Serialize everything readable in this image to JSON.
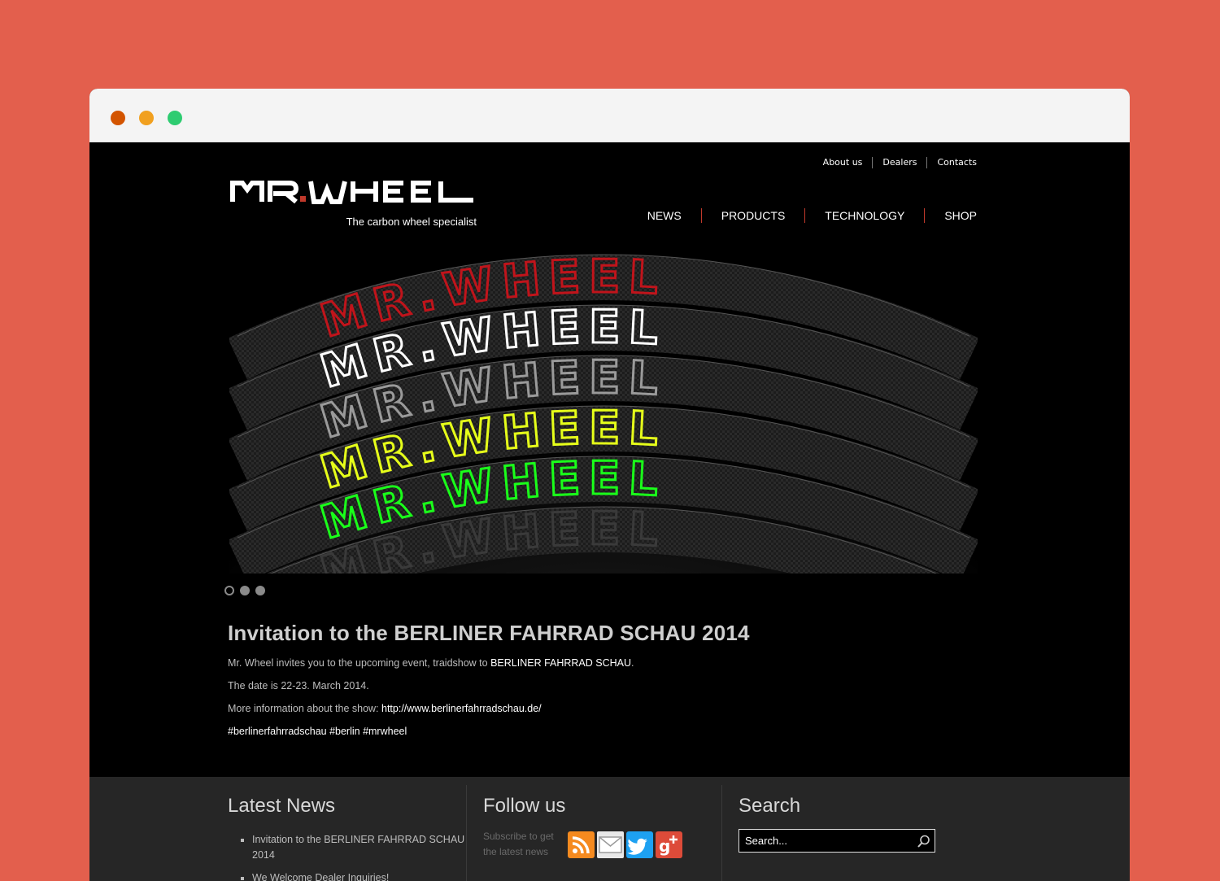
{
  "topnav": {
    "items": [
      "About us",
      "Dealers",
      "Contacts"
    ]
  },
  "logo": {
    "text": "MR. WHEEL",
    "tagline": "The carbon wheel specialist"
  },
  "mainnav": {
    "items": [
      "NEWS",
      "PRODUCTS",
      "TECHNOLOGY",
      "SHOP"
    ]
  },
  "hero": {
    "rim_text": "MR.WHEEL",
    "rim_colors": [
      "#c0141b",
      "#ffffff",
      "#9a9a9a",
      "#e6ff1a",
      "#1aff1a",
      "#3a3a3a"
    ]
  },
  "slider": {
    "count": 3,
    "active_index": 0
  },
  "article": {
    "title": "Invitation to the BERLINER FAHRRAD SCHAU 2014",
    "p1_prefix": "Mr. Wheel invites you to the upcoming event, traidshow to ",
    "p1_highlight": "BERLINER FAHRRAD SCHAU",
    "p1_suffix": ".",
    "p2": "The date is 22-23. March 2014.",
    "p3_prefix": "More information about the show: ",
    "p3_link": "http://www.berlinerfahrradschau.de/",
    "p4": "#berlinerfahrradschau #berlin #mrwheel"
  },
  "footer": {
    "latest_news": {
      "heading": "Latest News",
      "items": [
        "Invitation to the BERLINER FAHRRAD SCHAU 2014",
        "We Welcome Dealer Inquiries!"
      ]
    },
    "follow": {
      "heading": "Follow us",
      "subscribe_text": "Subscribe to get the latest news",
      "icons": [
        "rss-icon",
        "email-icon",
        "twitter-icon",
        "google-plus-icon"
      ]
    },
    "search": {
      "heading": "Search",
      "placeholder": "Search..."
    }
  },
  "colors": {
    "background": "#e35f4d",
    "accent": "#c0392b",
    "rss": "#f58a1f",
    "twitter": "#1da1f2",
    "google_plus": "#dd4b39"
  }
}
